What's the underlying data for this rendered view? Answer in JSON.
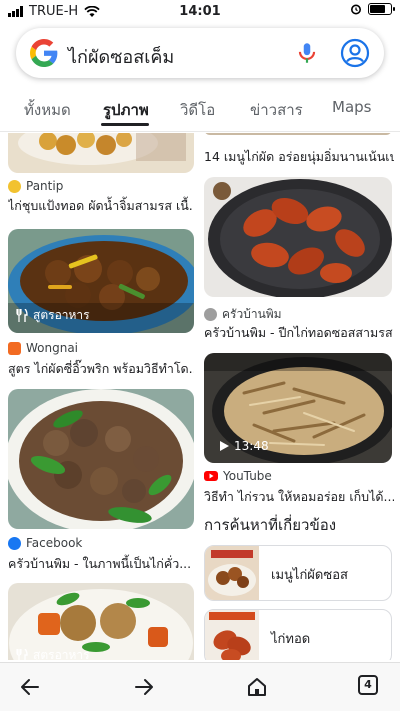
{
  "status_bar": {
    "carrier": "TRUE-H",
    "time": "14:01",
    "battery_level": 0.8
  },
  "search": {
    "query": "ไก่ผัดซอสเค็ม"
  },
  "tabs": [
    {
      "label": "ทั้งหมด",
      "active": false
    },
    {
      "label": "รูปภาพ",
      "active": true
    },
    {
      "label": "วิดีโอ",
      "active": false
    },
    {
      "label": "ข่าวสาร",
      "active": false
    },
    {
      "label": "Maps",
      "active": false
    }
  ],
  "results_left": [
    {
      "source": "Pantip",
      "title": "ไก่ชุบแป้งทอด ผัดน้ำจิ้มสามรส เนื้...",
      "badge": ""
    },
    {
      "source": "",
      "title": "",
      "badge": "สูตรอาหาร"
    },
    {
      "source": "Wongnai",
      "title": "สูตร ไก่ผัดซี่อิ๊วพริก พร้อมวิธีทำโด...",
      "badge": ""
    },
    {
      "source": "Facebook",
      "title": "ครัวบ้านพิม - ในภาพนี้เป็นไก่คั่ว...",
      "badge": ""
    },
    {
      "source": "",
      "title": "",
      "badge": "สูตรอาหาร"
    }
  ],
  "results_right": [
    {
      "source": "",
      "title": "14 เมนูไก่ผัด อร่อยนุ่มอิ่มนานเน้นเป..."
    },
    {
      "source": "ครัวบ้านพิม",
      "title": "ครัวบ้านพิม - ปีกไก่ทอดซอสสามรส"
    },
    {
      "source": "YouTube",
      "title": "วิธีทำ ไก่รวน ให้หอมอร่อย เก็บได้...",
      "duration": "13:48"
    }
  ],
  "related": {
    "heading": "การค้นหาที่เกี่ยวข้อง",
    "items": [
      {
        "label": "เมนูไก่ผัดซอส"
      },
      {
        "label": "ไก่ทอด"
      }
    ]
  },
  "bottom_bar": {
    "tab_count": "4"
  },
  "colors": {
    "accent_blue": "#4285F4",
    "youtube_red": "#FF0000",
    "facebook_blue": "#1877F2",
    "wongnai_orange": "#F26B22"
  }
}
